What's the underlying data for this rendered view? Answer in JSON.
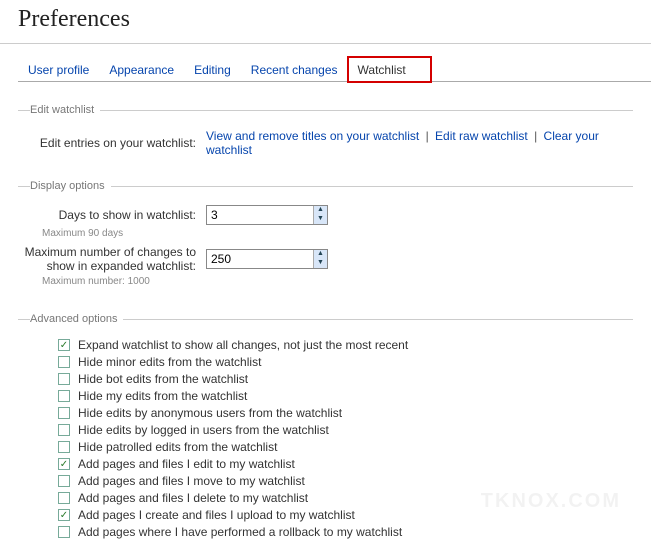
{
  "page_title": "Preferences",
  "tabs": [
    {
      "label": "User profile"
    },
    {
      "label": "Appearance"
    },
    {
      "label": "Editing"
    },
    {
      "label": "Recent changes"
    },
    {
      "label": "Watchlist"
    }
  ],
  "edit_section": {
    "legend": "Edit watchlist",
    "label": "Edit entries on your watchlist:",
    "links": {
      "view": "View and remove titles on your watchlist",
      "raw": "Edit raw watchlist",
      "clear": "Clear your watchlist"
    }
  },
  "display_section": {
    "legend": "Display options",
    "days_label": "Days to show in watchlist:",
    "days_value": "3",
    "days_hint": "Maximum 90 days",
    "max_label1": "Maximum number of changes to",
    "max_label2": "show in expanded watchlist:",
    "max_value": "250",
    "max_hint": "Maximum number: 1000"
  },
  "advanced_section": {
    "legend": "Advanced options",
    "options": [
      {
        "checked": true,
        "label": "Expand watchlist to show all changes, not just the most recent"
      },
      {
        "checked": false,
        "label": "Hide minor edits from the watchlist"
      },
      {
        "checked": false,
        "label": "Hide bot edits from the watchlist"
      },
      {
        "checked": false,
        "label": "Hide my edits from the watchlist"
      },
      {
        "checked": false,
        "label": "Hide edits by anonymous users from the watchlist"
      },
      {
        "checked": false,
        "label": "Hide edits by logged in users from the watchlist"
      },
      {
        "checked": false,
        "label": "Hide patrolled edits from the watchlist"
      },
      {
        "checked": true,
        "label": "Add pages and files I edit to my watchlist"
      },
      {
        "checked": false,
        "label": "Add pages and files I move to my watchlist"
      },
      {
        "checked": false,
        "label": "Add pages and files I delete to my watchlist"
      },
      {
        "checked": true,
        "label": "Add pages I create and files I upload to my watchlist"
      },
      {
        "checked": false,
        "label": "Add pages where I have performed a rollback to my watchlist"
      }
    ]
  },
  "watermark": "TKNOX.COM"
}
